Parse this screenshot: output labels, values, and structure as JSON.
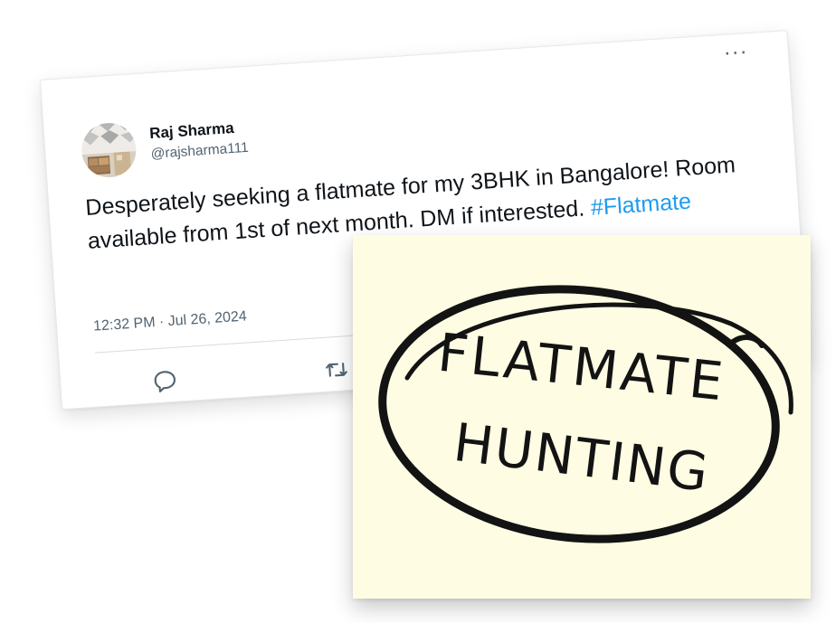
{
  "tweet": {
    "author_name": "Raj Sharma",
    "author_handle": "@rajsharma111",
    "text_before_hashtag": "Desperately seeking a flatmate for my 3BHK in Bangalore! Room available from 1st of next month. DM if interested. ",
    "hashtag": "#Flatmate",
    "time": "12:32 PM",
    "separator": " · ",
    "date": "Jul 26, 2024",
    "more_options_glyph": "···",
    "actions": [
      {
        "name": "reply",
        "icon": "speech-bubble-icon"
      },
      {
        "name": "retweet",
        "icon": "retweet-arrows-icon"
      }
    ]
  },
  "note": {
    "line1": "Flatmate",
    "line2": "Hunting",
    "background_color": "#fefde4",
    "ink_color": "#131313"
  },
  "colors": {
    "text_primary": "#0f1419",
    "text_secondary": "#536471",
    "hashtag": "#1d9bf0"
  }
}
